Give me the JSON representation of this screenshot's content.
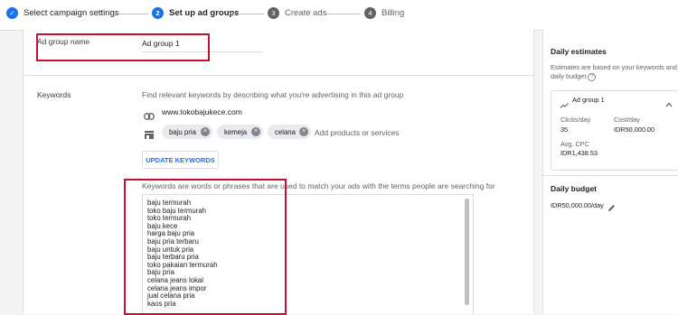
{
  "stepper": {
    "steps": [
      {
        "number": "✓",
        "label": "Select campaign settings",
        "state": "done"
      },
      {
        "number": "2",
        "label": "Set up ad groups",
        "state": "active"
      },
      {
        "number": "3",
        "label": "Create ads",
        "state": "todo"
      },
      {
        "number": "4",
        "label": "Billing",
        "state": "todo"
      }
    ]
  },
  "ad_group": {
    "label": "Ad group name",
    "value": "Ad group 1"
  },
  "keywords_section": {
    "label": "Keywords",
    "description": "Find relevant keywords by describing what you're advertising in this ad group",
    "url": "www.tokobajukece.com",
    "chips": [
      "baju pria",
      "kemeja",
      "celana"
    ],
    "products_placeholder": "Add products or services",
    "update_button": "UPDATE KEYWORDS",
    "hint": "Keywords are words or phrases that are used to match your ads with the terms people are searching for",
    "keyword_list": [
      "baju termurah",
      "toko baju termurah",
      "toko termurah",
      "baju kece",
      "harga baju pria",
      "baju pria terbaru",
      "baju untuk pria",
      "baju terbaru pria",
      "toko pakaian termurah",
      "baju pria",
      "celana jeans lokal",
      "celana jeans impor",
      "jual celana pria",
      "kaos pria"
    ]
  },
  "sidebar": {
    "daily_estimates_title": "Daily estimates",
    "estimates_note": "Estimates are based on your keywords and daily budget",
    "card": {
      "title": "Ad group 1",
      "clicks_label": "Clicks/day",
      "clicks_value": "35",
      "cost_label": "Cost/day",
      "cost_value": "IDR50,000.00",
      "cpc_label": "Avg. CPC",
      "cpc_value": "IDR1,438.53"
    },
    "daily_budget_title": "Daily budget",
    "daily_budget_value": "IDR50,000.00/day"
  },
  "colors": {
    "accent": "#1a73e8",
    "highlight_box": "#c8102e"
  }
}
